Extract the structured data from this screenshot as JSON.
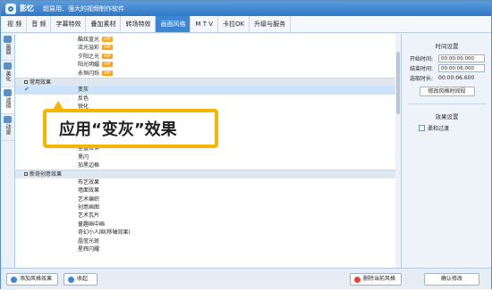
{
  "title": {
    "app_name": "影忆",
    "slogan": "超易用、强大的视频制作软件"
  },
  "tabs": [
    {
      "label": "视 频",
      "active": false
    },
    {
      "label": "音 频",
      "active": false
    },
    {
      "label": "字幕特效",
      "active": false
    },
    {
      "label": "叠加素材",
      "active": false
    },
    {
      "label": "转场特效",
      "active": false
    },
    {
      "label": "画面风格",
      "active": true
    },
    {
      "label": "M T V",
      "active": false
    },
    {
      "label": "卡拉OK",
      "active": false
    },
    {
      "label": "升级与服务",
      "active": false
    }
  ],
  "left_tools": [
    {
      "label": "画面",
      "icon": "image-icon",
      "active": false
    },
    {
      "label": "美化",
      "icon": "magic-wand-icon",
      "active": false
    },
    {
      "label": "滤镜",
      "icon": "filter-icon",
      "active": true
    },
    {
      "label": "动景",
      "icon": "motion-icon",
      "active": false
    }
  ],
  "list": {
    "vip_badge": "VIP",
    "rows": [
      {
        "type": "item",
        "label": "酷炫蓝光",
        "vip": true
      },
      {
        "type": "item",
        "label": "流光溢彩",
        "vip": true
      },
      {
        "type": "item",
        "label": "夕阳之光",
        "vip": true
      },
      {
        "type": "item",
        "label": "阳光明媚",
        "vip": true
      },
      {
        "type": "item",
        "label": "永恒闪烁",
        "vip": true
      },
      {
        "type": "group",
        "label": "常用效果"
      },
      {
        "type": "item",
        "label": "变灰",
        "selected": true
      },
      {
        "type": "item",
        "label": "反色"
      },
      {
        "type": "item",
        "label": "锐化"
      },
      {
        "type": "item",
        "label": "模糊"
      },
      {
        "type": "item",
        "label": "色调"
      },
      {
        "type": "item",
        "label": "马赛克"
      },
      {
        "type": "item",
        "label": "水平翻转"
      },
      {
        "type": "item",
        "label": "垂直拉伸"
      },
      {
        "type": "item",
        "label": "黑闪"
      },
      {
        "type": "item",
        "label": "加黑边框"
      },
      {
        "type": "group",
        "label": "新奇创意效果"
      },
      {
        "type": "item",
        "label": "布艺效果"
      },
      {
        "type": "item",
        "label": "墙面效果"
      },
      {
        "type": "item",
        "label": "艺术编织"
      },
      {
        "type": "item",
        "label": "创意画图"
      },
      {
        "type": "item",
        "label": "艺术瓦片"
      },
      {
        "type": "item",
        "label": "童趣画中画"
      },
      {
        "type": "item",
        "label": "奇幻小人国(移轴效果)"
      },
      {
        "type": "item",
        "label": "晶莹光斑"
      },
      {
        "type": "item",
        "label": "星辉闪耀"
      }
    ]
  },
  "callout": {
    "text": "应用“变灰”效果"
  },
  "right": {
    "time_title": "时间设置",
    "start_label": "开始时间:",
    "start_value": "00:00:00.000",
    "end_label": "结束时间:",
    "end_value": "00:00:06.000",
    "duration_label": "选取时长:",
    "duration_value": "00:00:06.600",
    "modify_time_button": "修改风格时间段",
    "effect_title": "效果设置",
    "soft_transition": "柔和过渡",
    "confirm_button": "确认修改"
  },
  "bottom": {
    "add_button": "添加风格效果",
    "collapse_button": "收起",
    "delete_button": "删除当前风格"
  }
}
